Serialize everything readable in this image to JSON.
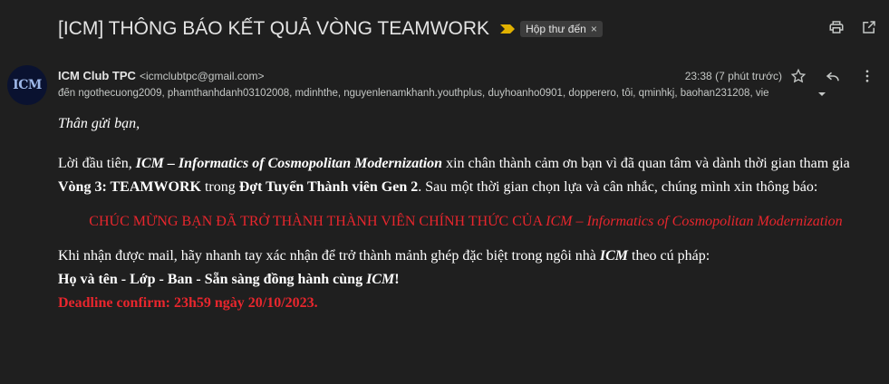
{
  "email": {
    "subject": "[ICM] THÔNG BÁO KẾT QUẢ VÒNG TEAMWORK",
    "label": "Hộp thư đến",
    "label_remove": "×",
    "sender_name": "ICM Club TPC",
    "sender_email": "<icmclubtpc@gmail.com>",
    "timestamp": "23:38 (7 phút trước)",
    "recipients": "đến ngothecuong2009, phamthanhdanh03102008, mdinhthe, nguyenlenamkhanh.youthplus, duyhoanho0901, dopperero, tôi, qminhkj, baohan231208, vie",
    "avatar_text": "ICM"
  },
  "body": {
    "greeting": "Thân gửi bạn,",
    "intro_1": "Lời đầu tiên, ",
    "intro_icm": "ICM – Informatics of Cosmopolitan Modernization",
    "intro_2": " xin chân thành cảm ơn bạn vì đã quan tâm và dành thời gian tham gia ",
    "intro_round": "Vòng 3: TEAMWORK",
    "intro_3": " trong ",
    "intro_batch": "Đợt Tuyển Thành viên Gen 2",
    "intro_4": ". Sau một thời gian chọn lựa và cân nhắc, chúng mình xin thông báo:",
    "announce_1": "CHÚC MỪNG BẠN ĐÃ TRỞ THÀNH THÀNH VIÊN CHÍNH THỨC CỦA ",
    "announce_icm": "ICM – Informatics of Cosmopolitan Modernization",
    "instruct_1": "Khi nhận được mail, hãy nhanh tay xác nhận để trở thành mảnh ghép đặc biệt trong ngôi nhà ",
    "instruct_icm": "ICM",
    "instruct_2": " theo cú pháp:",
    "syntax_1": "Họ và tên - Lớp - Ban - Sẵn sàng đồng hành cùng ",
    "syntax_icm": "ICM",
    "syntax_2": "!",
    "deadline": "Deadline confirm: 23h59 ngày 20/10/2023."
  },
  "icons": [
    "importance-marker-icon",
    "print-icon",
    "open-new-window-icon",
    "star-icon",
    "reply-icon",
    "more-vert-icon",
    "chevron-down-icon"
  ],
  "colors": {
    "background": "#1f1f1f",
    "accent_red": "#e8262d",
    "importance": "#e1b100"
  }
}
